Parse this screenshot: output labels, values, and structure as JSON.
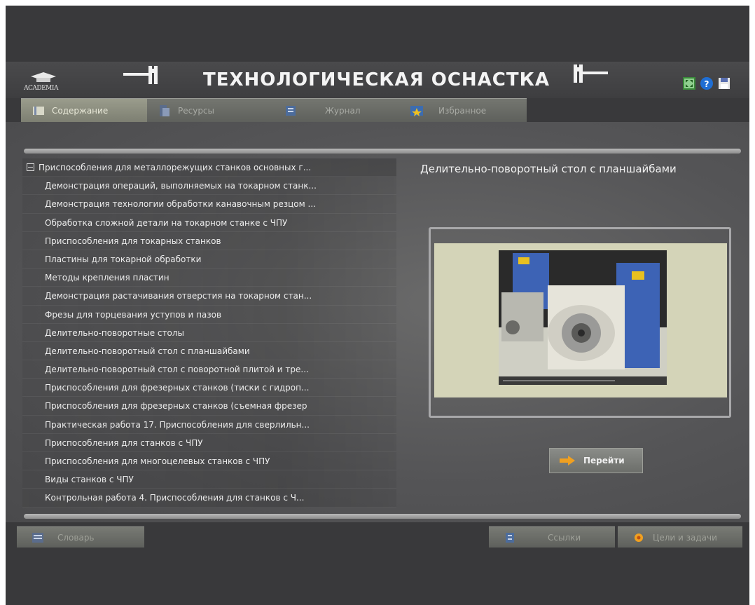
{
  "header": {
    "logo_text": "ACADEMIA",
    "title": "ТЕХНОЛОГИЧЕСКАЯ ОСНАСТКА",
    "icons": [
      "fullscreen-icon",
      "help-icon",
      "save-icon"
    ]
  },
  "tabs": [
    {
      "label": "Содержание",
      "icon": "book-icon",
      "active": true
    },
    {
      "label": "Ресурсы",
      "icon": "resources-icon",
      "active": false
    },
    {
      "label": "Журнал",
      "icon": "journal-icon",
      "active": false
    },
    {
      "label": "Избранное",
      "icon": "favorites-icon",
      "active": false
    }
  ],
  "tree": {
    "root": "Приспособления для металлорежущих станков основных г...",
    "items": [
      "Демонстрация операций, выполняемых на токарном станк...",
      "Демонстрация технологии обработки канавочным резцом ...",
      "Обработка сложной детали на токарном станке с ЧПУ",
      "Приспособления для токарных станков",
      "Пластины для токарной обработки",
      "Методы крепления пластин",
      "Демонстрация растачивания отверстия на токарном стан...",
      "Фрезы для торцевания уступов и пазов",
      "Делительно-поворотные столы",
      "Делительно-поворотный стол с планшайбами",
      "Делительно-поворотный стол с поворотной плитой и тре...",
      "Приспособления для фрезерных станков (тиски с гидроп...",
      "Приспособления для фрезерных станков (съемная фрезер",
      "Практическая работа 17. Приспособления для сверлильн...",
      "Приспособления для станков с ЧПУ",
      "Приспособления для многоцелевых станков с ЧПУ",
      "Виды станков с ЧПУ",
      "Контрольная работа 4. Приспособления для станков с Ч..."
    ]
  },
  "detail": {
    "title": "Делительно-поворотный стол с планшайбами",
    "go_label": "Перейти"
  },
  "footer": {
    "glossary_label": "Словарь",
    "links_label": "Ссылки",
    "goals_label": "Цели и задачи"
  },
  "colors": {
    "background": "#39393b",
    "tab_active": "#9a9c8c",
    "accent_orange": "#f0a020",
    "video_bg": "#d4d4b8"
  }
}
